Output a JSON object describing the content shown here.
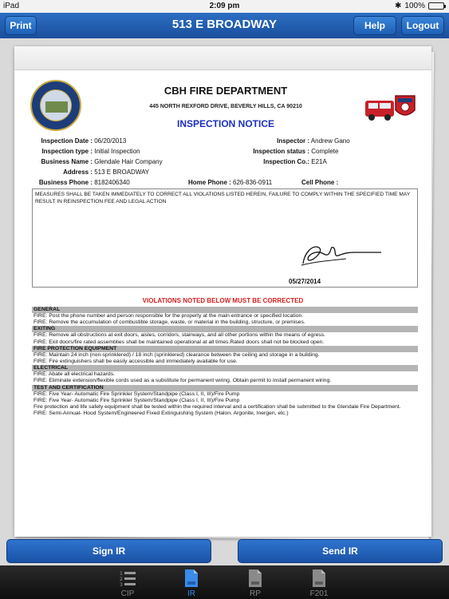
{
  "status_bar": {
    "device": "iPad",
    "time": "2:09 pm",
    "battery_percent": "100%"
  },
  "nav_bar": {
    "title": "513 E BROADWAY",
    "print_label": "Print",
    "help_label": "Help",
    "logout_label": "Logout"
  },
  "document": {
    "department": "CBH FIRE DEPARTMENT",
    "address_line": "445 NORTH REXFORD DRIVE, BEVERLY HILLS, CA 90210",
    "notice_title": "INSPECTION NOTICE",
    "fields": {
      "inspection_date_label": "Inspection Date :",
      "inspection_date_value": "06/20/2013",
      "inspector_label": "Inspector :",
      "inspector_value": "Andrew Gano",
      "inspection_type_label": "Inspection type :",
      "inspection_type_value": "Initial Inspection",
      "inspection_status_label": "Inspection status :",
      "inspection_status_value": "Complete",
      "business_name_label": "Business Name :",
      "business_name_value": "Glendale Hair Company",
      "inspection_co_label": "Inspection Co.:",
      "inspection_co_value": "E21A",
      "address_label": "Address :",
      "address_value": "513 E BROADWAY",
      "business_phone_label": "Business Phone :",
      "business_phone_value": "8182406340",
      "home_phone_label": "Home Phone :",
      "home_phone_value": "626-836-0911",
      "cell_phone_label": "Cell Phone :",
      "cell_phone_value": ""
    },
    "notice_text": "MEASURES SHALL BE TAKEN IMMEDIATELY TO CORRECT ALL VIOLATIONS LISTED HEREIN, FAILURE TO COMPLY WITHIN THE SPECIFIED TIME MAY RESULT IN REINSPECTION FEE AND LEGAL ACTION",
    "signature_date": "05/27/2014",
    "violations_heading": "VIOLATIONS NOTED BELOW MUST BE CORRECTED",
    "violations": [
      {
        "category": "GENERAL",
        "items": [
          "FIRE: Post the phone number and person responsible for the property at the main entrance or specified location.",
          "FIRE: Remove the accumulation of combustible storage, waste, or material in the building, structure, or premises."
        ]
      },
      {
        "category": "EXITING",
        "items": [
          "FIRE: Remove all obstructions at exit doors, aisles, corridors, stairways, and all other portions within the means of egress.",
          "FIRE: Exit doors/fire rated assemblies shall be maintained operational at all times.Rated doors shall not be blocked open."
        ]
      },
      {
        "category": "FIRE PROTECTION EQUIPMENT",
        "items": [
          "FIRE: Maintain 24 inch (non-sprinklered) / 18 inch (sprinklered) clearance between the ceiling and storage in a building.",
          "FIRE: Fire extinguishers shall be easily accessible and immediately available for use."
        ]
      },
      {
        "category": "ELECTRICAL",
        "items": [
          "FIRE: Abate all electrical hazards.",
          "FIRE: Eliminate extension/flexible cords used as a substitute for permanent wiring. Obtain permit to install permanent wiring."
        ]
      },
      {
        "category": "TEST AND CERTIFICATION",
        "items": [
          "FIRE: Five Year- Automatic Fire Sprinkler System/Standpipe (Class I, II, III)/Fire Pump",
          "FIRE: Five Year- Automatic Fire Sprinkler System/Standpipe (Class I, II, III)/Fire Pump",
          "Fire protection and life safety equipment shall be tested within the required interval and a certification shall be submitted to the Glendale Fire Department.",
          "FIRE: Semi-Annual- Hood System/Engineered Fixed Extinguishing System (Halon, Argonite, Inergen, etc.)"
        ]
      }
    ]
  },
  "bottom_buttons": {
    "sign_label": "Sign IR",
    "send_label": "Send IR"
  },
  "tabs": [
    {
      "label": "CIP",
      "icon": "list-icon",
      "active": false
    },
    {
      "label": "IR",
      "icon": "document-icon",
      "active": true
    },
    {
      "label": "RP",
      "icon": "document-icon",
      "active": false
    },
    {
      "label": "F201",
      "icon": "document-icon",
      "active": false
    }
  ],
  "colors": {
    "nav_blue": "#1a4f9c",
    "notice_blue": "#1a2fc0",
    "violation_red": "#d41e1e",
    "active_tab": "#3b8be8"
  }
}
